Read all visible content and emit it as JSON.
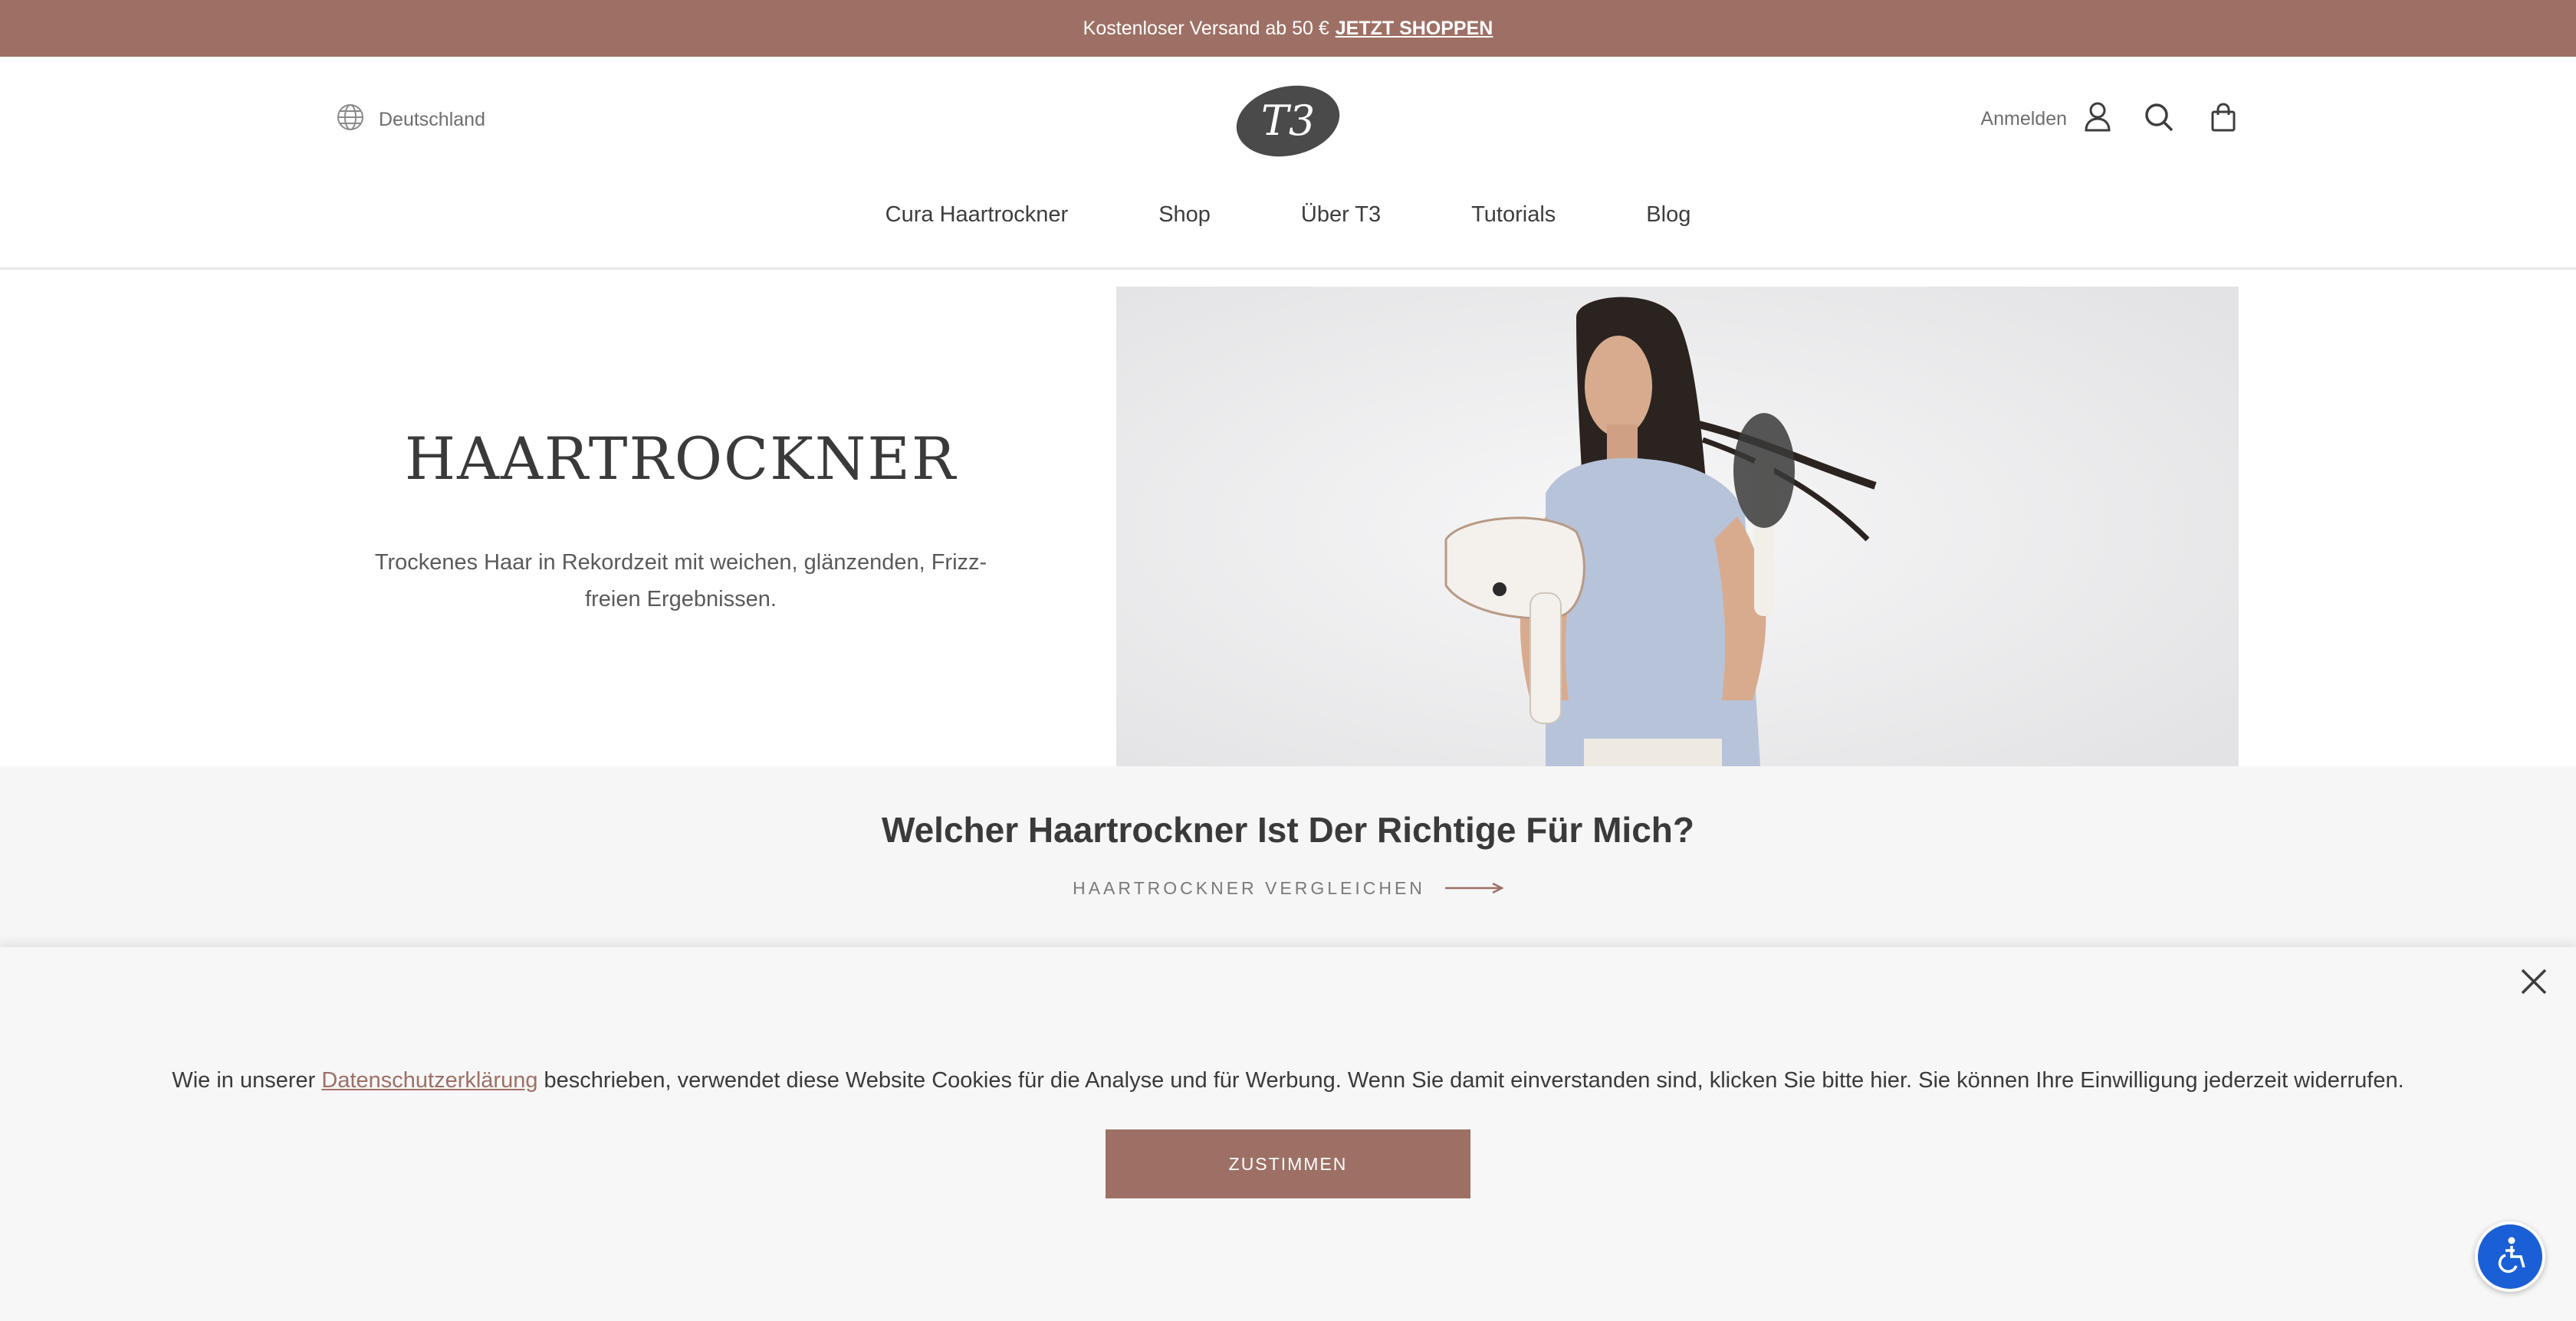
{
  "announcement": {
    "text": "Kostenloser Versand ab 50 €",
    "link": "JETZT SHOPPEN"
  },
  "header": {
    "country": "Deutschland",
    "logo_text": "T3",
    "signin": "Anmelden",
    "icons": [
      "globe-icon",
      "user-icon",
      "search-icon",
      "bag-icon"
    ]
  },
  "nav": {
    "items": [
      "Cura Haartrockner",
      "Shop",
      "Über T3",
      "Tutorials",
      "Blog"
    ]
  },
  "hero": {
    "title": "HAARTROCKNER",
    "subtitle": "Trockenes Haar in Rekordzeit mit weichen, glänzenden, Frizz-freien Ergebnissen."
  },
  "compare": {
    "title": "Welcher Haartrockner Ist Der Richtige Für Mich?",
    "link": "HAARTROCKNER VERGLEICHEN"
  },
  "cookie": {
    "text_before": "Wie in unserer",
    "link": "Datenschutzerklärung",
    "text_after": "beschrieben, verwendet diese Website Cookies für die Analyse und für Werbung. Wenn Sie damit einverstanden sind, klicken Sie bitte hier. Sie können Ihre Einwilligung jederzeit widerrufen.",
    "button": "ZUSTIMMEN"
  },
  "colors": {
    "brand": "#9e7065",
    "accessibility": "#1a5fd6"
  }
}
